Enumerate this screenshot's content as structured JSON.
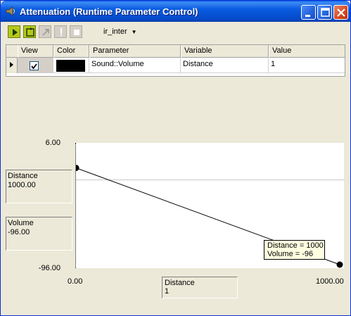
{
  "window": {
    "title": "Attenuation (Runtime Parameter Control)",
    "title_bar_color": "#0a5ce0",
    "buttons": {
      "minimize": "minimize-icon",
      "maximize": "maximize-icon",
      "close": "close-icon"
    }
  },
  "toolbar": {
    "tools": [
      {
        "name": "play-icon",
        "state": "enabled"
      },
      {
        "name": "refresh-icon",
        "state": "enabled"
      },
      {
        "name": "reset-icon",
        "state": "disabled"
      },
      {
        "name": "exclamation-icon",
        "state": "disabled"
      },
      {
        "name": "stop-icon",
        "state": "disabled"
      }
    ],
    "rtpc_dropdown": {
      "value": "ir_inter"
    },
    "active_color": "#b5c81d"
  },
  "grid": {
    "columns": [
      "View",
      "Color",
      "Parameter",
      "Variable",
      "Value"
    ],
    "rows": [
      {
        "view": true,
        "color": "#000000",
        "parameter": "Sound::Volume",
        "variable": "Distance",
        "value": "1"
      }
    ]
  },
  "chart_data": {
    "type": "line",
    "x": [
      0,
      1000
    ],
    "y": [
      -15,
      -96
    ],
    "xlim": [
      0,
      1000
    ],
    "ylim": [
      -96,
      6
    ],
    "x_tick_labels": [
      "0.00",
      "1000.00"
    ],
    "y_tick_labels": [
      "6.00",
      "-96.00"
    ],
    "grid": false
  },
  "graph": {
    "cursor_y_value": -25,
    "x_readout": {
      "variable": "Distance",
      "value": "1000.00"
    },
    "y_readout": {
      "variable": "Volume",
      "value": "-96.00"
    },
    "bottom_readout": {
      "variable": "Distance",
      "value": "1"
    },
    "tooltip": {
      "line1": "Distance = 1000",
      "line2": "Volume = -96"
    }
  }
}
